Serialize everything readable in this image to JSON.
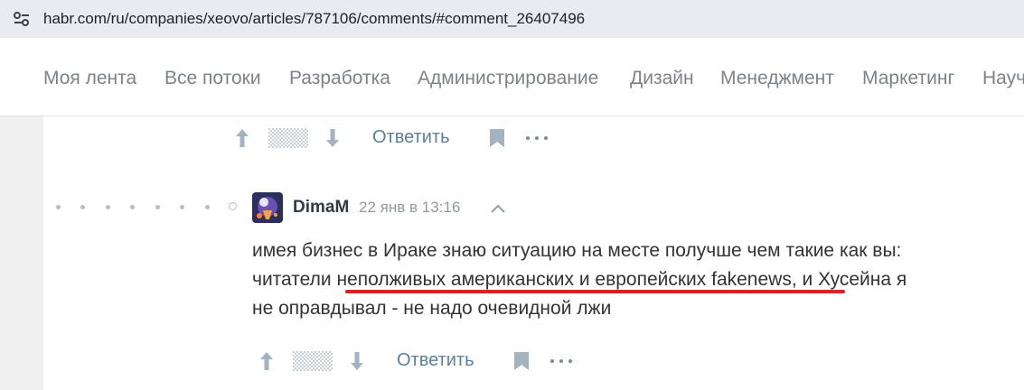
{
  "browser": {
    "url": "habr.com/ru/companies/xeovo/articles/787106/comments/#comment_26407496"
  },
  "nav": {
    "items": [
      "Моя лента",
      "Все потоки",
      "Разработка",
      "Администрирование",
      "Дизайн",
      "Менеджмент",
      "Маркетинг",
      "Научпоп"
    ]
  },
  "top_actions": {
    "reply_label": "Ответить"
  },
  "comment": {
    "author": "DimaM",
    "timestamp": "22 янв в 13:16",
    "lines": [
      "имея бизнес в Ираке знаю ситуацию на месте получше чем такие как вы:",
      "читатели неполживых американских и европейских fakenews, и Хусейна я",
      "не оправдывал - не надо очевидной лжи"
    ],
    "reply_label": "Ответить"
  },
  "colors": {
    "highlight_underline": "#d9212c",
    "link": "#5e7f9b"
  }
}
